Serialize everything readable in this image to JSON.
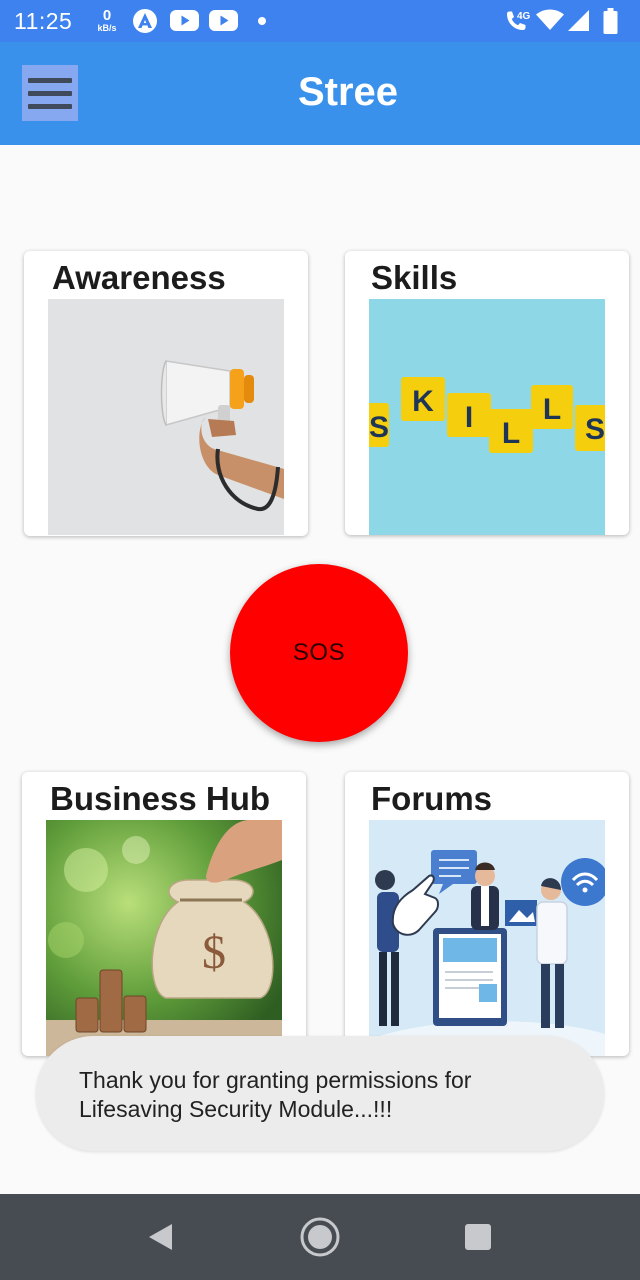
{
  "status_bar": {
    "time": "11:25",
    "net_speed_value": "0",
    "net_speed_unit": "kB/s",
    "network_label": "4G",
    "icons": [
      "arc-app-icon",
      "youtube-icon",
      "youtube-icon",
      "notification-dot-icon",
      "volte-call-icon",
      "wifi-icon",
      "signal-icon",
      "battery-icon"
    ]
  },
  "app_bar": {
    "title": "Stree",
    "menu_icon": "hamburger-menu-icon"
  },
  "cards": {
    "awareness": {
      "title": "Awareness",
      "image": "megaphone-photo"
    },
    "skills": {
      "title": "Skills",
      "image": "skills-letter-tiles-photo",
      "tiles": [
        "S",
        "K",
        "I",
        "L",
        "L",
        "S"
      ]
    },
    "business": {
      "title": "Business Hub",
      "image": "money-bag-coins-photo",
      "bag_symbol": "$"
    },
    "forums": {
      "title": "Forums",
      "image": "people-discussion-illustration"
    }
  },
  "sos": {
    "label": "SOS"
  },
  "toast": {
    "message": "Thank you for granting permissions for Lifesaving Security Module...!!!"
  },
  "nav_bar": {
    "buttons": [
      "back-icon",
      "home-icon",
      "recents-icon"
    ]
  },
  "colors": {
    "status_bar": "#3d82ee",
    "app_bar": "#3a91ec",
    "sos": "#ff0000",
    "toast_bg": "#ececec",
    "nav_bar": "#474b52"
  }
}
